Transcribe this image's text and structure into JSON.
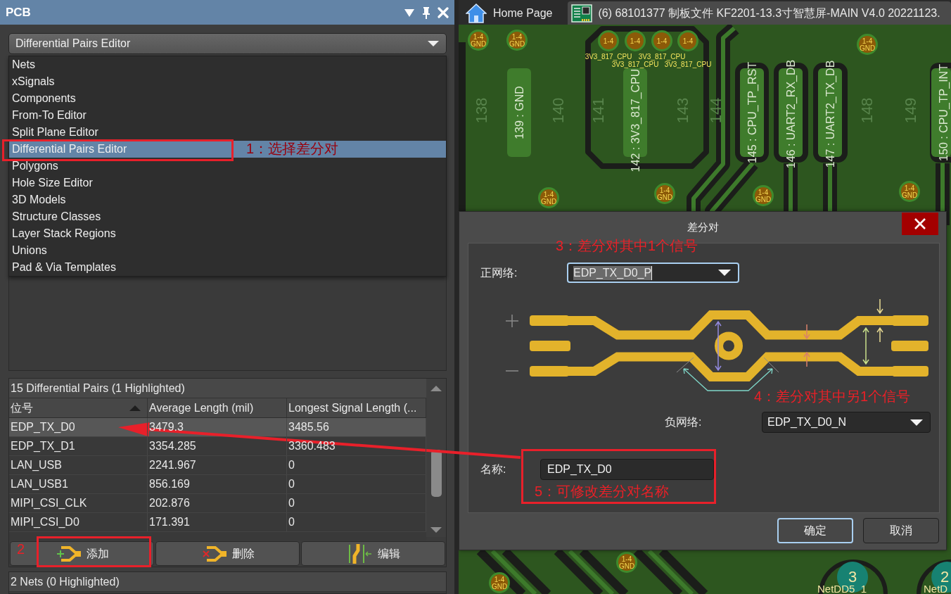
{
  "panel": {
    "title": "PCB",
    "view_select": {
      "value": "Differential Pairs Editor"
    },
    "view_menu": [
      {
        "label": "Nets",
        "selected": false
      },
      {
        "label": "xSignals",
        "selected": false
      },
      {
        "label": "Components",
        "selected": false
      },
      {
        "label": "From-To Editor",
        "selected": false
      },
      {
        "label": "Split Plane Editor",
        "selected": false
      },
      {
        "label": "Differential Pairs Editor",
        "selected": true
      },
      {
        "label": "Polygons",
        "selected": false
      },
      {
        "label": "Hole Size Editor",
        "selected": false
      },
      {
        "label": "3D Models",
        "selected": false
      },
      {
        "label": "Structure Classes",
        "selected": false
      },
      {
        "label": "Layer Stack Regions",
        "selected": false
      },
      {
        "label": "Unions",
        "selected": false
      },
      {
        "label": "Pad & Via Templates",
        "selected": false
      }
    ],
    "pairs_table": {
      "title": "15 Differential Pairs (1 Highlighted)",
      "columns": [
        {
          "label": "位号",
          "sorted": true
        },
        {
          "label": "Average Length (mil)",
          "sorted": false
        },
        {
          "label": "Longest Signal Length (...",
          "sorted": false
        }
      ],
      "rows": [
        {
          "cells": [
            "EDP_TX_D0",
            "3479.3",
            "3485.56"
          ],
          "selected": true
        },
        {
          "cells": [
            "EDP_TX_D1",
            "3354.285",
            "3360.483"
          ],
          "selected": false
        },
        {
          "cells": [
            "LAN_USB",
            "2241.967",
            "0"
          ],
          "selected": false
        },
        {
          "cells": [
            "LAN_USB1",
            "856.169",
            "0"
          ],
          "selected": false
        },
        {
          "cells": [
            "MIPI_CSI_CLK",
            "202.876",
            "0"
          ],
          "selected": false
        },
        {
          "cells": [
            "MIPI_CSI_D0",
            "171.391",
            "0"
          ],
          "selected": false
        }
      ]
    },
    "buttons": [
      {
        "label": "添加",
        "kind": "add"
      },
      {
        "label": "删除",
        "kind": "remove"
      },
      {
        "label": "编辑",
        "kind": "edit"
      }
    ],
    "nets_table": {
      "title": "2 Nets (0 Highlighted)"
    }
  },
  "document_tabs": [
    {
      "label": "Home Page",
      "kind": "home",
      "selected": false
    },
    {
      "label": "(6) 68101377 制板文件 KF2201-13.3寸智慧屏-MAIN V4.0 20221123.",
      "kind": "pcb",
      "selected": true
    }
  ],
  "pcb": {
    "grid_numbers": [
      "138",
      "140",
      "141",
      "143",
      "144",
      "148",
      "149"
    ],
    "net_labels": [
      "139 : GND",
      "142 : 3V3_817_CPU",
      "145 : CPU_TP_RST",
      "146 : UART2_RX_DB",
      "147 : UART2_TX_DB",
      "150 : CPU_TP_INT"
    ],
    "pads": [
      {
        "layers": "1-4",
        "net": "3V3_817_CPU"
      },
      {
        "layers": "1-4",
        "net": "3V3_817_CPU"
      },
      {
        "layers": "1-4",
        "net": "3V3_817_CPU"
      },
      {
        "layers": "1-4",
        "net": "3V3_817_CPU"
      }
    ],
    "vias": [
      {
        "layers": "1-4",
        "net": "GND"
      },
      {
        "layers": "1-4",
        "net": "GND"
      },
      {
        "layers": "1-4",
        "net": "GND"
      },
      {
        "layers": "1-4",
        "net": "GND"
      },
      {
        "layers": "1-4",
        "net": "GND"
      },
      {
        "layers": "1-4",
        "net": "GND"
      },
      {
        "layers": "1-4",
        "net": "GND"
      },
      {
        "layers": "1-4",
        "net": "GND"
      },
      {
        "layers": "1-4",
        "net": "GND"
      }
    ],
    "pins": [
      {
        "number": "3",
        "net": "NetDD5_1"
      },
      {
        "number": "2",
        "net": "NetD"
      }
    ]
  },
  "dialog": {
    "title": "差分对",
    "positive_net": {
      "label": "正网络:",
      "value": "EDP_TX_D0_P",
      "focused": true
    },
    "negative_net": {
      "label": "负网络:",
      "value": "EDP_TX_D0_N",
      "focused": false
    },
    "name": {
      "label": "名称:",
      "value": "EDP_TX_D0"
    },
    "buttons": [
      {
        "label": "确定",
        "default": true
      },
      {
        "label": "取消",
        "default": false
      }
    ]
  },
  "annotations": [
    {
      "kind": "boxed_callout",
      "text": "1：选择差分对"
    },
    {
      "kind": "boxed_callout",
      "text": "2"
    },
    {
      "kind": "arrow"
    },
    {
      "kind": "callout",
      "text": "3：差分对其中1个信号"
    },
    {
      "kind": "callout",
      "text": "4：差分对其中另1个信号"
    },
    {
      "kind": "boxed_callout",
      "text": "5：可修改差分对名称"
    }
  ]
}
